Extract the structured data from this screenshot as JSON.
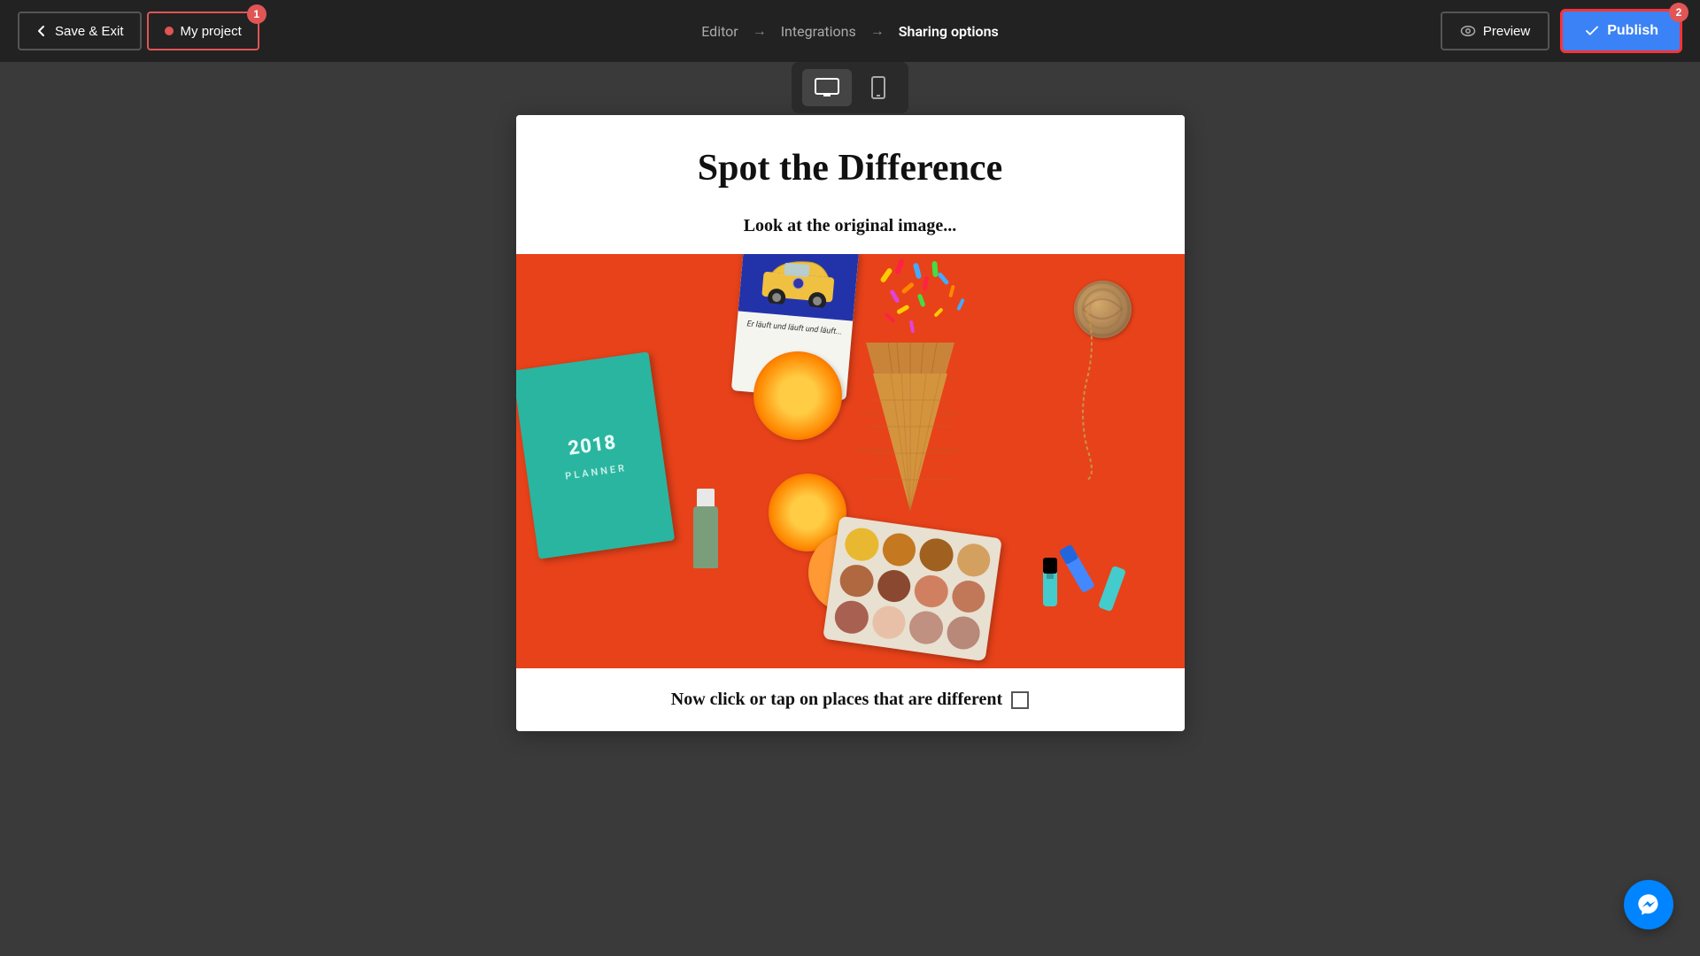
{
  "topbar": {
    "save_exit_label": "Save & Exit",
    "project_name": "My project",
    "project_badge": "1",
    "nav_steps": [
      {
        "id": "editor",
        "label": "Editor"
      },
      {
        "id": "integrations",
        "label": "Integrations"
      },
      {
        "id": "sharing",
        "label": "Sharing options"
      }
    ],
    "preview_label": "Preview",
    "publish_label": "Publish",
    "publish_badge": "2",
    "devices": [
      {
        "id": "desktop",
        "label": "Desktop",
        "active": true
      },
      {
        "id": "mobile",
        "label": "Mobile",
        "active": false
      }
    ]
  },
  "canvas": {
    "title": "Spot the Difference",
    "subtitle": "Look at the original image...",
    "footer_text": "Now click or tap on places that are different",
    "planner_year": "2018",
    "planner_label": "PLANNER",
    "vw_text": "Er läuft und läuft und läuft...",
    "palette_colors": [
      "#e8b830",
      "#c47820",
      "#a06020",
      "#d4a060",
      "#b06840",
      "#8a4830",
      "#d08060",
      "#c07858",
      "#a86050",
      "#e8c0a8",
      "#c09080",
      "#b88878"
    ]
  },
  "messenger": {
    "label": "Messenger"
  }
}
